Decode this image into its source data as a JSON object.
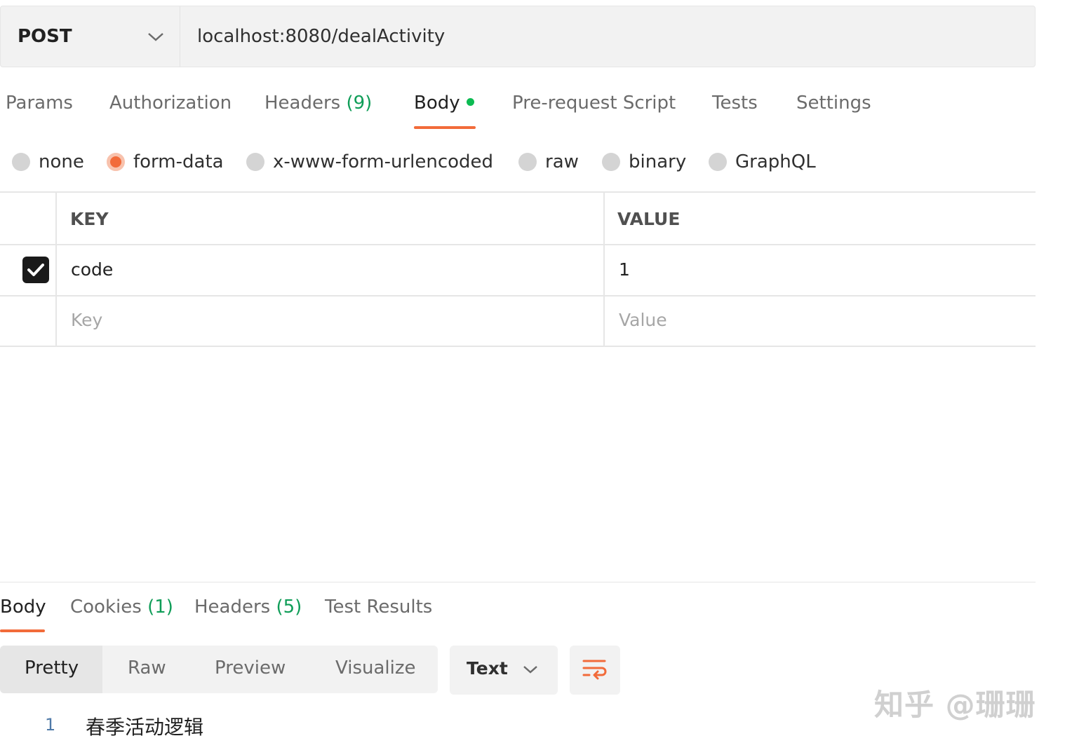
{
  "request": {
    "method": "POST",
    "url": "localhost:8080/dealActivity"
  },
  "request_tabs": [
    {
      "label": "Params",
      "count": ""
    },
    {
      "label": "Authorization",
      "count": ""
    },
    {
      "label": "Headers",
      "count": "(9)"
    },
    {
      "label": "Body",
      "count": "",
      "active": true
    },
    {
      "label": "Pre-request Script",
      "count": ""
    },
    {
      "label": "Tests",
      "count": ""
    },
    {
      "label": "Settings",
      "count": ""
    }
  ],
  "body_types": [
    {
      "label": "none",
      "selected": false
    },
    {
      "label": "form-data",
      "selected": true
    },
    {
      "label": "x-www-form-urlencoded",
      "selected": false
    },
    {
      "label": "raw",
      "selected": false
    },
    {
      "label": "binary",
      "selected": false
    },
    {
      "label": "GraphQL",
      "selected": false
    }
  ],
  "table": {
    "headers": [
      "KEY",
      "VALUE"
    ],
    "rows": [
      {
        "checked": true,
        "key": "code",
        "value": "1"
      }
    ],
    "placeholder_key": "Key",
    "placeholder_value": "Value"
  },
  "response_tabs": [
    {
      "label": "Body",
      "count": "",
      "active": true
    },
    {
      "label": "Cookies",
      "count": "(1)"
    },
    {
      "label": "Headers",
      "count": "(5)"
    },
    {
      "label": "Test Results",
      "count": ""
    }
  ],
  "view_modes": [
    "Pretty",
    "Raw",
    "Preview",
    "Visualize"
  ],
  "format_select": "Text",
  "response_lines": [
    {
      "no": "1",
      "text": "春季活动逻辑"
    }
  ],
  "watermark": "知乎 @珊珊",
  "colors": {
    "accent": "#f26b3a",
    "count_green": "#0f9d58",
    "dot_green": "#0cbb52"
  },
  "icons": [
    "chevron-down-icon",
    "checkmark-icon",
    "wrap-lines-icon"
  ]
}
